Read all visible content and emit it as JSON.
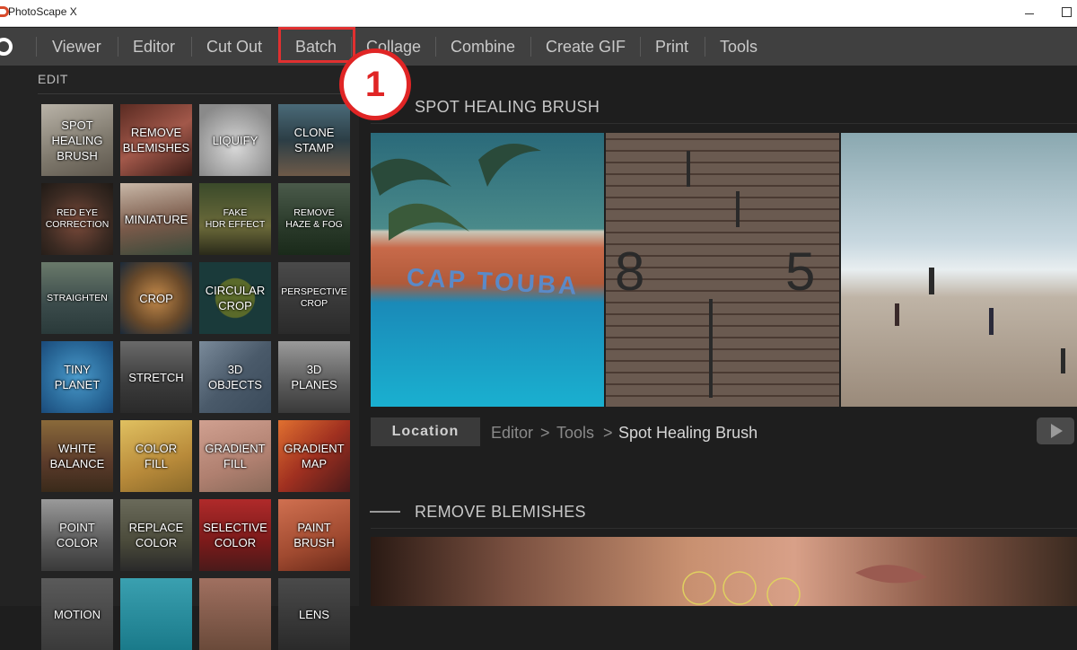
{
  "window": {
    "title": "PhotoScape X"
  },
  "menu": {
    "items": [
      "Viewer",
      "Editor",
      "Cut Out",
      "Batch",
      "Collage",
      "Combine",
      "Create GIF",
      "Print",
      "Tools"
    ],
    "highlighted": "Batch"
  },
  "annotation": {
    "step": "1",
    "color": "#e02525"
  },
  "sidebar": {
    "section_label": "EDIT",
    "tools": [
      "SPOT\nHEALING\nBRUSH",
      "REMOVE\nBLEMISHES",
      "LIQUIFY",
      "CLONE\nSTAMP",
      "RED EYE\nCORRECTION",
      "MINIATURE",
      "FAKE\nHDR EFFECT",
      "REMOVE\nHAZE & FOG",
      "STRAIGHTEN",
      "CROP",
      "CIRCULAR\nCROP",
      "PERSPECTIVE\nCROP",
      "TINY\nPLANET",
      "STRETCH",
      "3D\nOBJECTS",
      "3D\nPLANES",
      "WHITE\nBALANCE",
      "COLOR\nFILL",
      "GRADIENT\nFILL",
      "GRADIENT\nMAP",
      "POINT\nCOLOR",
      "REPLACE\nCOLOR",
      "SELECTIVE\nCOLOR",
      "PAINT\nBRUSH",
      "MOTION",
      "",
      "",
      "LENS"
    ]
  },
  "main": {
    "section1": {
      "title": "SPOT HEALING BRUSH",
      "photo1_text": "CAP TOUBA",
      "photo2_text_left": "8",
      "photo2_text_right": "5",
      "location_label": "Location",
      "breadcrumb": [
        "Editor",
        ">",
        "Tools",
        ">",
        "Spot Healing Brush"
      ]
    },
    "section2": {
      "title": "REMOVE BLEMISHES"
    }
  },
  "colors": {
    "accent_red": "#e03030",
    "menubar": "#404040",
    "background": "#1e1e1e"
  }
}
